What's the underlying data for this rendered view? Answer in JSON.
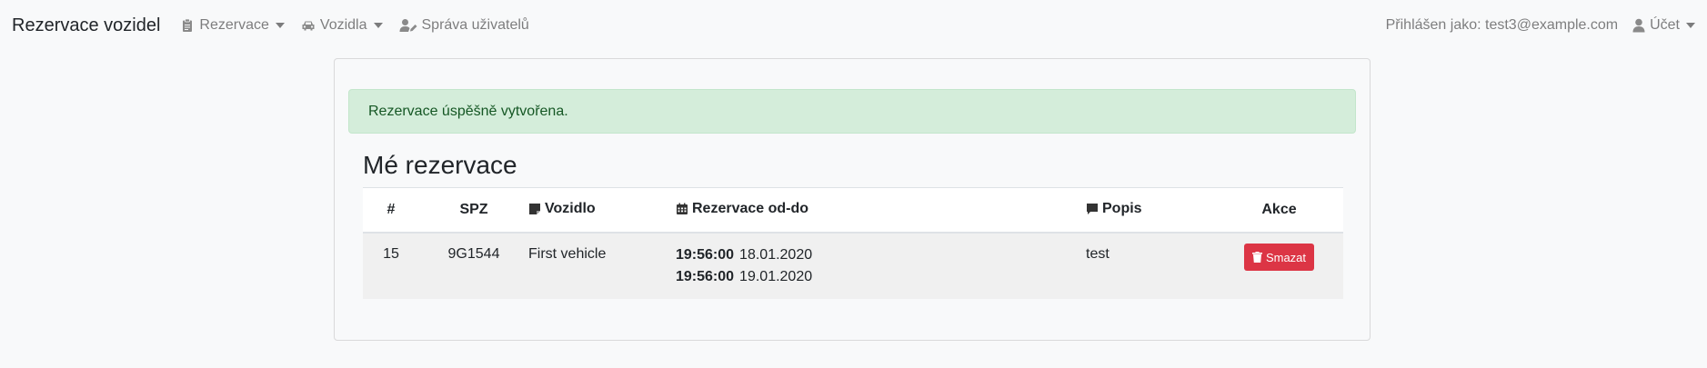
{
  "navbar": {
    "brand": "Rezervace vozidel",
    "menu": [
      {
        "label": "Rezervace",
        "icon": "clipboard-icon",
        "dropdown": true
      },
      {
        "label": "Vozidla",
        "icon": "car-icon",
        "dropdown": true
      },
      {
        "label": "Správa uživatelů",
        "icon": "user-edit-icon",
        "dropdown": false
      }
    ],
    "logged_in_text": "Přihlášen jako: test3@example.com",
    "account": {
      "label": "Účet",
      "icon": "user-icon",
      "dropdown": true
    }
  },
  "alert": {
    "message": "Rezervace úspěšně vytvořena.",
    "color": "#155724",
    "background": "#d4edda"
  },
  "page_title": "Mé rezervace",
  "table": {
    "headers": {
      "num": "#",
      "spz": "SPZ",
      "vehicle": "Vozidlo",
      "vehicle_icon": "sticky-note-icon",
      "dates": "Rezervace od-do",
      "dates_icon": "calendar-icon",
      "description": "Popis",
      "description_icon": "comment-icon",
      "actions": "Akce"
    },
    "rows": [
      {
        "num": "15",
        "spz": "9G1544",
        "vehicle": "First vehicle",
        "from_time": "19:56:00",
        "from_date": "18.01.2020",
        "to_time": "19:56:00",
        "to_date": "19.01.2020",
        "description": "test",
        "delete_label": "Smazat",
        "delete_icon": "trash-icon"
      }
    ]
  },
  "colors": {
    "danger": "#dc3545",
    "muted_nav": "rgba(0,0,0,0.5)"
  }
}
